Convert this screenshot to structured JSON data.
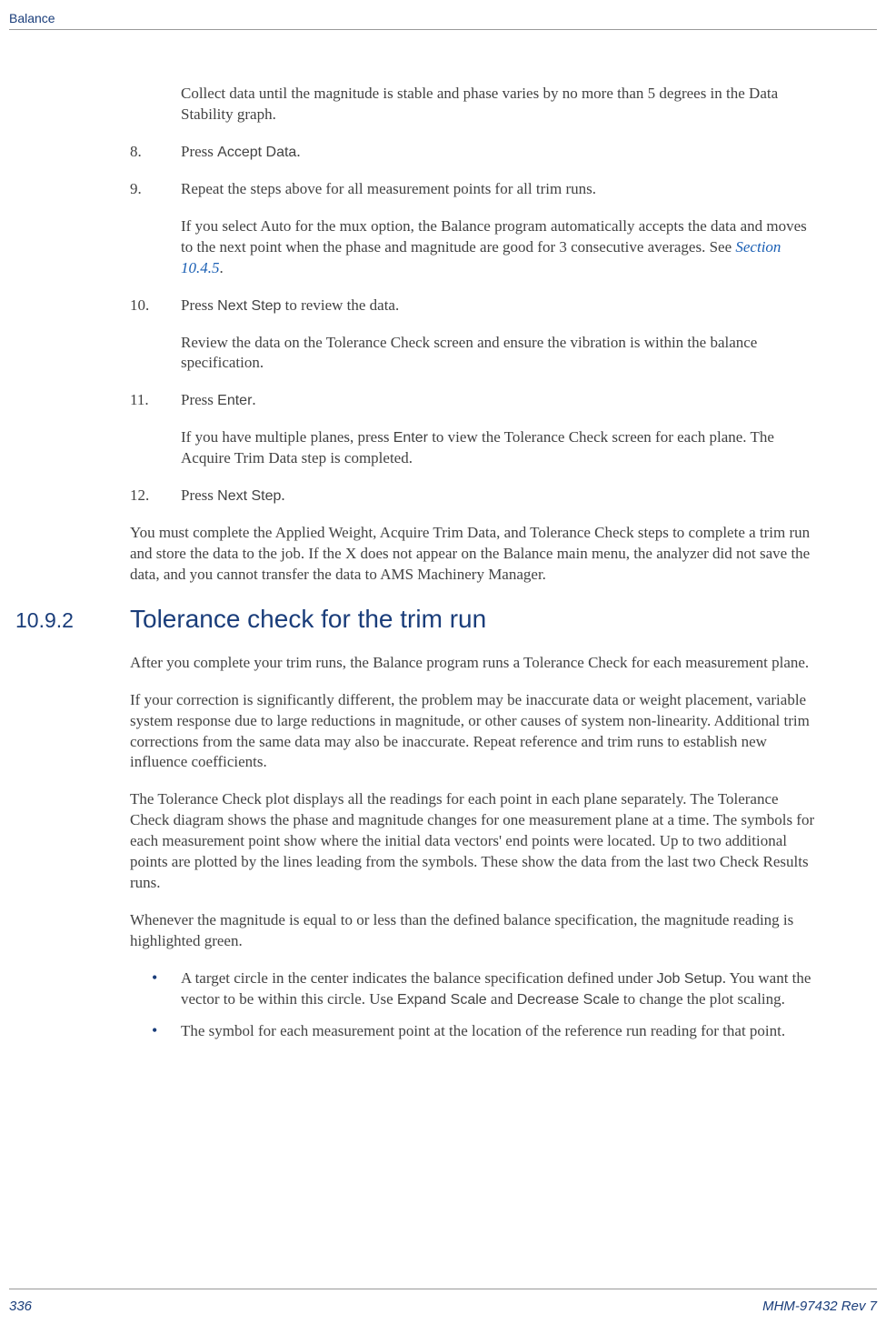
{
  "header": {
    "section": "Balance"
  },
  "intro": "Collect data until the magnitude is stable and phase varies by no more than 5 degrees in the Data Stability graph.",
  "steps": [
    {
      "num": "8.",
      "parts": [
        {
          "t": "Press ",
          "k": "text"
        },
        {
          "t": "Accept Data",
          "k": "ui"
        },
        {
          "t": ".",
          "k": "text"
        }
      ]
    },
    {
      "num": "9.",
      "parts": [
        {
          "t": "Repeat the steps above for all measurement points for all trim runs.",
          "k": "text"
        }
      ],
      "sub": [
        {
          "t": "If you select Auto for the mux option, the Balance program automatically accepts the data and moves to the next point when the phase and magnitude are good for 3 consecutive averages. See ",
          "k": "text"
        },
        {
          "t": "Section 10.4.5",
          "k": "link"
        },
        {
          "t": ".",
          "k": "text"
        }
      ]
    },
    {
      "num": "10.",
      "parts": [
        {
          "t": "Press ",
          "k": "text"
        },
        {
          "t": "Next Step",
          "k": "ui"
        },
        {
          "t": " to review the data.",
          "k": "text"
        }
      ],
      "sub": [
        {
          "t": "Review the data on the Tolerance Check screen and ensure the vibration is within the balance specification.",
          "k": "text"
        }
      ]
    },
    {
      "num": "11.",
      "parts": [
        {
          "t": "Press ",
          "k": "text"
        },
        {
          "t": "Enter",
          "k": "ui"
        },
        {
          "t": ".",
          "k": "text"
        }
      ],
      "sub": [
        {
          "t": "If you have multiple planes, press ",
          "k": "text"
        },
        {
          "t": "Enter",
          "k": "ui"
        },
        {
          "t": " to view the Tolerance Check screen for each plane. The Acquire Trim Data step is completed.",
          "k": "text"
        }
      ]
    },
    {
      "num": "12.",
      "parts": [
        {
          "t": "Press ",
          "k": "text"
        },
        {
          "t": "Next Step",
          "k": "ui"
        },
        {
          "t": ".",
          "k": "text"
        }
      ]
    }
  ],
  "closing": "You must complete the Applied Weight, Acquire Trim Data, and Tolerance Check steps to complete a trim run and store the data to the job. If the X does not appear on the Balance main menu, the analyzer did not save the data, and you cannot transfer the data to AMS Machinery Manager.",
  "section": {
    "num": "10.9.2",
    "title": "Tolerance check for the trim run"
  },
  "body": [
    "After you complete your trim runs, the Balance program runs a Tolerance Check for each measurement plane.",
    "If your correction is significantly different, the problem may be inaccurate data or weight placement, variable system response due to large reductions in magnitude, or other causes of system non-linearity. Additional trim corrections from the same data may also be inaccurate. Repeat reference and trim runs to establish new influence coefficients.",
    "The Tolerance Check plot displays all the readings for each point in each plane separately. The Tolerance Check diagram shows the phase and magnitude changes for one measurement plane at a time. The symbols for each measurement point show where the initial data vectors' end points were located. Up to two additional points are plotted by the lines leading from the symbols. These show the data from the last two Check Results runs.",
    "Whenever the magnitude is equal to or less than the defined balance specification, the magnitude reading is highlighted green."
  ],
  "bullets": [
    {
      "parts": [
        {
          "t": "A target circle in the center indicates the balance specification defined under ",
          "k": "text"
        },
        {
          "t": "Job Setup",
          "k": "ui"
        },
        {
          "t": ". You want the vector to be within this circle. Use ",
          "k": "text"
        },
        {
          "t": "Expand Scale",
          "k": "ui"
        },
        {
          "t": " and ",
          "k": "text"
        },
        {
          "t": "Decrease Scale",
          "k": "ui"
        },
        {
          "t": " to change the plot scaling.",
          "k": "text"
        }
      ]
    },
    {
      "parts": [
        {
          "t": "The symbol for each measurement point at the location of the reference run reading for that point.",
          "k": "text"
        }
      ]
    }
  ],
  "footer": {
    "page": "336",
    "doc": "MHM-97432 Rev 7"
  }
}
